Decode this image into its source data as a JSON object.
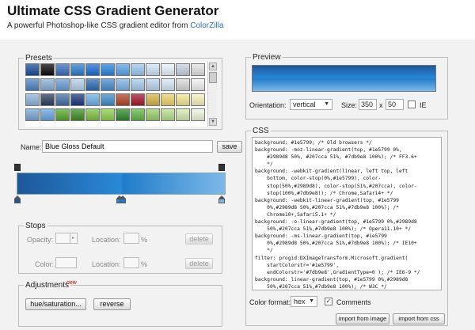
{
  "header": {
    "title": "Ultimate CSS Gradient Generator",
    "subtitle_prefix": "A powerful Photoshop-like CSS gradient editor from ",
    "subtitle_link": "ColorZilla"
  },
  "presets": {
    "legend": "Presets",
    "scroll_up": "▲",
    "scroll_down": "▼",
    "swatch_rows": [
      [
        "#1b4f9e",
        "#0c0c0c",
        "#3a6fc1",
        "#2f7fd0",
        "#1e6fd8",
        "#2a85e0",
        "#5aa6ec",
        "#9ccaf3",
        "#cfe6fb",
        "#e9f3fd",
        "#c8d4e0",
        "#e4e4e4"
      ],
      [
        "#4f86c4",
        "#8ab0d8",
        "#6a9fd8",
        "#b6d2ee",
        "#2d6fb3",
        "#4a8ed0",
        "#7fb5e6",
        "#a7cdf0",
        "#bcd6ef",
        "#d8e8f6",
        "#dadada",
        "#f3f3f3"
      ],
      [
        "#8fb6de",
        "#2f3f5f",
        "#4570a8",
        "#203a80",
        "#6fb2ea",
        "#3f8ecc",
        "#b3472a",
        "#a6192e",
        "#d9b64a",
        "#eed56b",
        "#f6e88e",
        "#fbf3c0"
      ],
      [
        "#7aa7d6",
        "#6aa7e0",
        "#57aa2e",
        "#3f8f26",
        "#7cc242",
        "#8fd14f",
        "#2e8b2e",
        "#63b84a",
        "#9ad06a",
        "#b9e08b",
        "#d6ecb0",
        "#eef7dd"
      ]
    ]
  },
  "name_row": {
    "label": "Name:",
    "value": "Blue Gloss Default",
    "save_label": "save"
  },
  "gradient": {
    "colors": [
      "#1e5799",
      "#2989d8",
      "#207cca",
      "#7db9e8"
    ],
    "stops_percent": [
      0,
      50,
      51,
      100
    ],
    "opacity_stops_percent": [
      0,
      100
    ]
  },
  "stops": {
    "legend": "Stops",
    "opacity_label": "Opacity:",
    "location_label": "Location:",
    "color_label": "Color:",
    "percent": "%",
    "delete_label": "delete"
  },
  "adjustments": {
    "legend": "Adjustments",
    "new_badge": "new",
    "hue_label": "hue/saturation...",
    "reverse_label": "reverse"
  },
  "preview": {
    "legend": "Preview",
    "orientation_label": "Orientation:",
    "orientation_value": "vertical",
    "size_label": "Size:",
    "width": "350",
    "x_sep": "x",
    "height": "50",
    "ie_label": "IE",
    "ie_checked": false
  },
  "css": {
    "legend": "CSS",
    "code": "background: #1e5799; /* Old browsers */\nbackground: -moz-linear-gradient(top, #1e5799 0%,\n    #2989d8 50%, #207cca 51%, #7db9e8 100%); /* FF3.6+\n    */\nbackground: -webkit-gradient(linear, left top, left\n    bottom, color-stop(0%,#1e5799), color-\n    stop(50%,#2989d8), color-stop(51%,#207cca), color-\n    stop(100%,#7db9e8)); /* Chrome,Safari4+ */\nbackground: -webkit-linear-gradient(top, #1e5799\n    0%,#2989d8 50%,#207cca 51%,#7db9e8 100%); /*\n    Chrome10+,Safari5.1+ */\nbackground: -o-linear-gradient(top, #1e5799 0%,#2989d8\n    50%,#207cca 51%,#7db9e8 100%); /* Opera11.10+ */\nbackground: -ms-linear-gradient(top, #1e5799\n    0%,#2989d8 50%,#207cca 51%,#7db9e8 100%); /* IE10+\n    */\nfilter: progid:DXImageTransform.Microsoft.gradient(\n    startColorstr='#1e5799',\n    endColorstr='#7db9e8',GradientType=0 ); /* IE6-9 */\nbackground: linear-gradient(top, #1e5799 0%,#2989d8\n    50%,#207cca 51%,#7db9e8 100%); /* W3C */",
    "color_format_label": "Color format:",
    "color_format_value": "hex",
    "comments_label": "Comments",
    "comments_checked": true,
    "import_image_label": "import from image",
    "import_css_label": "import from css"
  },
  "icons": {
    "caret": "▼",
    "check": "✓"
  }
}
